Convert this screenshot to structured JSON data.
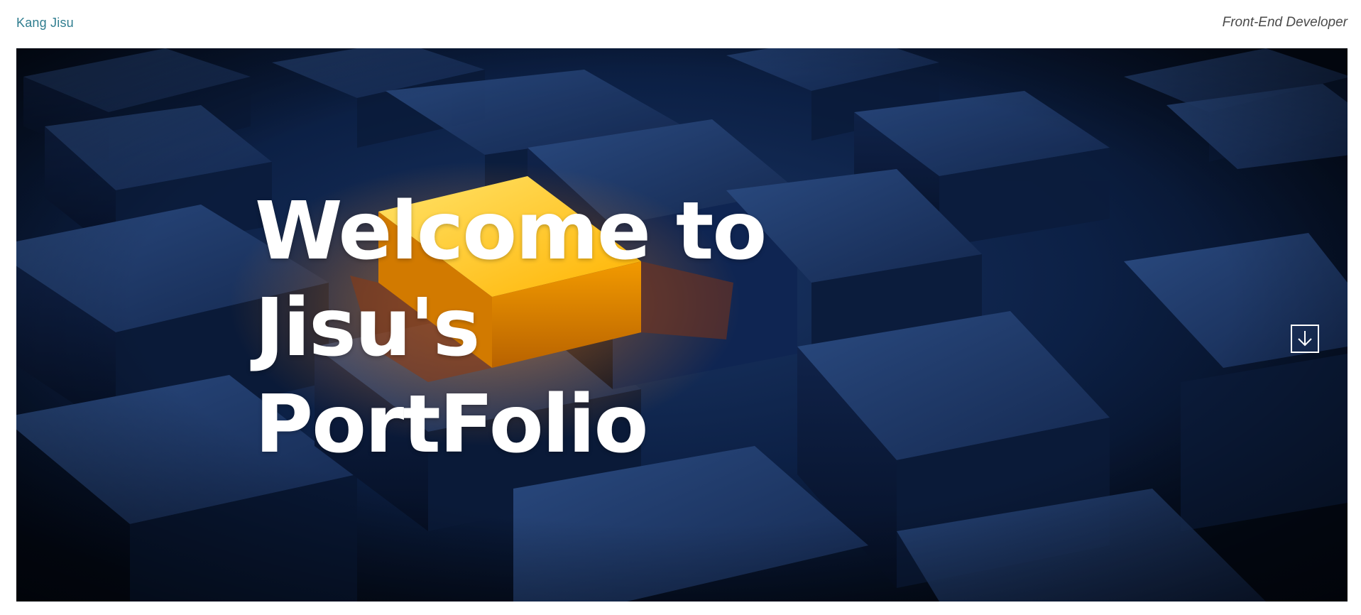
{
  "header": {
    "brand_name": "Kang Jisu",
    "role": "Front-End Developer"
  },
  "hero": {
    "headline_lines": [
      "Welcome to",
      "Jisu's",
      "PortFolio"
    ],
    "scroll_button_icon": "arrow-down-icon"
  },
  "colors": {
    "brand_text": "#2f7d8f",
    "role_text": "#4a4a4a",
    "hero_dark": "#07162e",
    "cube_blue": "#1b3563",
    "accent_gold": "#ffc21a",
    "headline": "#ffffff"
  }
}
